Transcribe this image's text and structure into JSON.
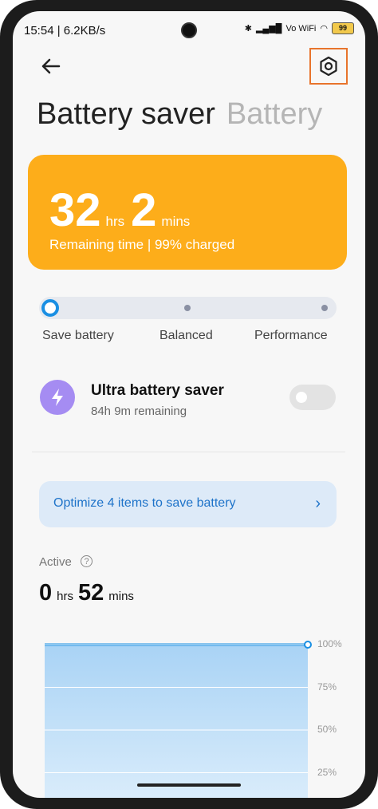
{
  "status": {
    "time": "15:54 | 6.2KB/s",
    "signal_text": "Vo WiFi",
    "battery": "99"
  },
  "tabs": {
    "active": "Battery saver",
    "inactive": "Battery"
  },
  "card": {
    "hours": "32",
    "hours_unit": "hrs",
    "mins": "2",
    "mins_unit": "mins",
    "subtitle": "Remaining time | 99% charged",
    "color": "#fdad1a"
  },
  "modes": {
    "selected": "Save battery",
    "items": [
      "Save battery",
      "Balanced",
      "Performance"
    ]
  },
  "ultra": {
    "title": "Ultra battery saver",
    "subtitle": "84h 9m remaining",
    "enabled": false
  },
  "optimize": {
    "label": "Optimize 4 items to save battery"
  },
  "active": {
    "label": "Active",
    "hours": "0",
    "hours_unit": "hrs",
    "mins": "52",
    "mins_unit": "mins"
  },
  "chart_data": {
    "type": "area",
    "series": [
      {
        "values": [
          100,
          100
        ]
      }
    ],
    "yticks": [
      "100%",
      "75%",
      "50%",
      "25%"
    ],
    "ylim": [
      0,
      100
    ],
    "grid": true
  }
}
